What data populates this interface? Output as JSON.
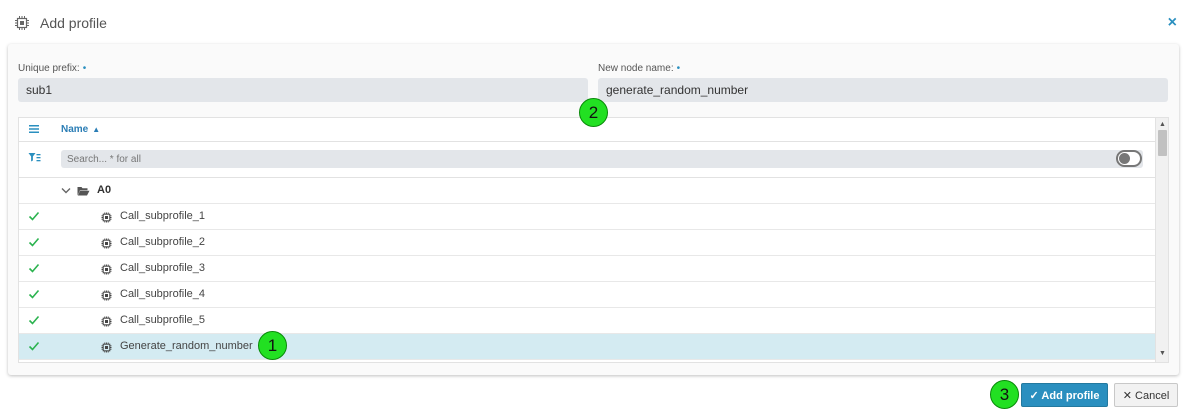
{
  "dialog": {
    "title": "Add profile",
    "close_glyph": "×"
  },
  "form": {
    "prefix_label": "Unique prefix:",
    "prefix_required": "•",
    "prefix_value": "sub1",
    "node_label": "New node name:",
    "node_required": "•",
    "node_value": "generate_random_number"
  },
  "grid": {
    "column_name": "Name",
    "sort_glyph": "▲",
    "search_placeholder": "Search... * for all",
    "group": {
      "label": "A0"
    },
    "rows": [
      {
        "label": "Call_subprofile_1",
        "checked": true,
        "selected": false
      },
      {
        "label": "Call_subprofile_2",
        "checked": true,
        "selected": false
      },
      {
        "label": "Call_subprofile_3",
        "checked": true,
        "selected": false
      },
      {
        "label": "Call_subprofile_4",
        "checked": true,
        "selected": false
      },
      {
        "label": "Call_subprofile_5",
        "checked": true,
        "selected": false
      },
      {
        "label": "Generate_random_number",
        "checked": true,
        "selected": true
      }
    ]
  },
  "annotations": [
    "1",
    "2",
    "3"
  ],
  "buttons": {
    "add_label": "Add profile",
    "cancel_label": "Cancel",
    "add_glyph": "✓",
    "cancel_glyph": "✕"
  },
  "colors": {
    "accent": "#2a8fbf",
    "check": "#2bb34f",
    "selected_row": "#d4ebf2",
    "badge": "#22e022"
  }
}
